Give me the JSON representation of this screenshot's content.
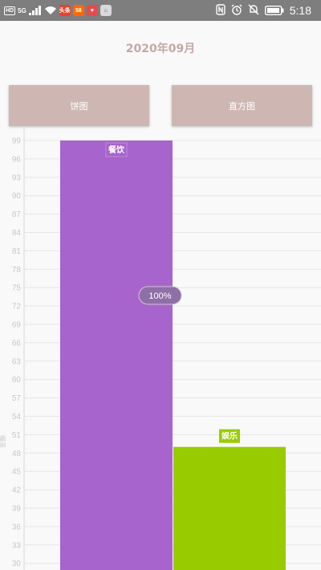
{
  "status_bar": {
    "left_items": [
      "HD",
      "5G"
    ],
    "app_badges": [
      {
        "label": "头条",
        "color": "#e8412c"
      },
      {
        "label": "58",
        "color": "#ff6a00"
      },
      {
        "label": "♥",
        "color": "#e84a4a"
      },
      {
        "label": "⌂",
        "color": "#d9d9d9"
      }
    ],
    "battery": "⚡",
    "time": "5:18"
  },
  "header": {
    "month": "2020年09月"
  },
  "buttons": {
    "pie_label": "饼图",
    "bar_label": "直方图"
  },
  "colors": {
    "accent": "#ceb7b3",
    "title": "#c2a9a6",
    "bar_food": "#a864cd",
    "bar_ent": "#99cc00"
  },
  "chart_data": {
    "type": "bar",
    "categories": [
      "餐饮",
      "娱乐"
    ],
    "values": [
      99,
      49
    ],
    "colors": [
      "#a864cd",
      "#99cc00"
    ],
    "y_ticks": [
      99,
      96,
      93,
      90,
      87,
      84,
      81,
      78,
      75,
      72,
      69,
      66,
      63,
      60,
      57,
      54,
      51,
      48,
      45,
      42,
      39,
      36,
      33,
      30
    ],
    "ylim": [
      30,
      100
    ],
    "ylabel": "金额",
    "grid": true,
    "tooltip": "100%"
  }
}
